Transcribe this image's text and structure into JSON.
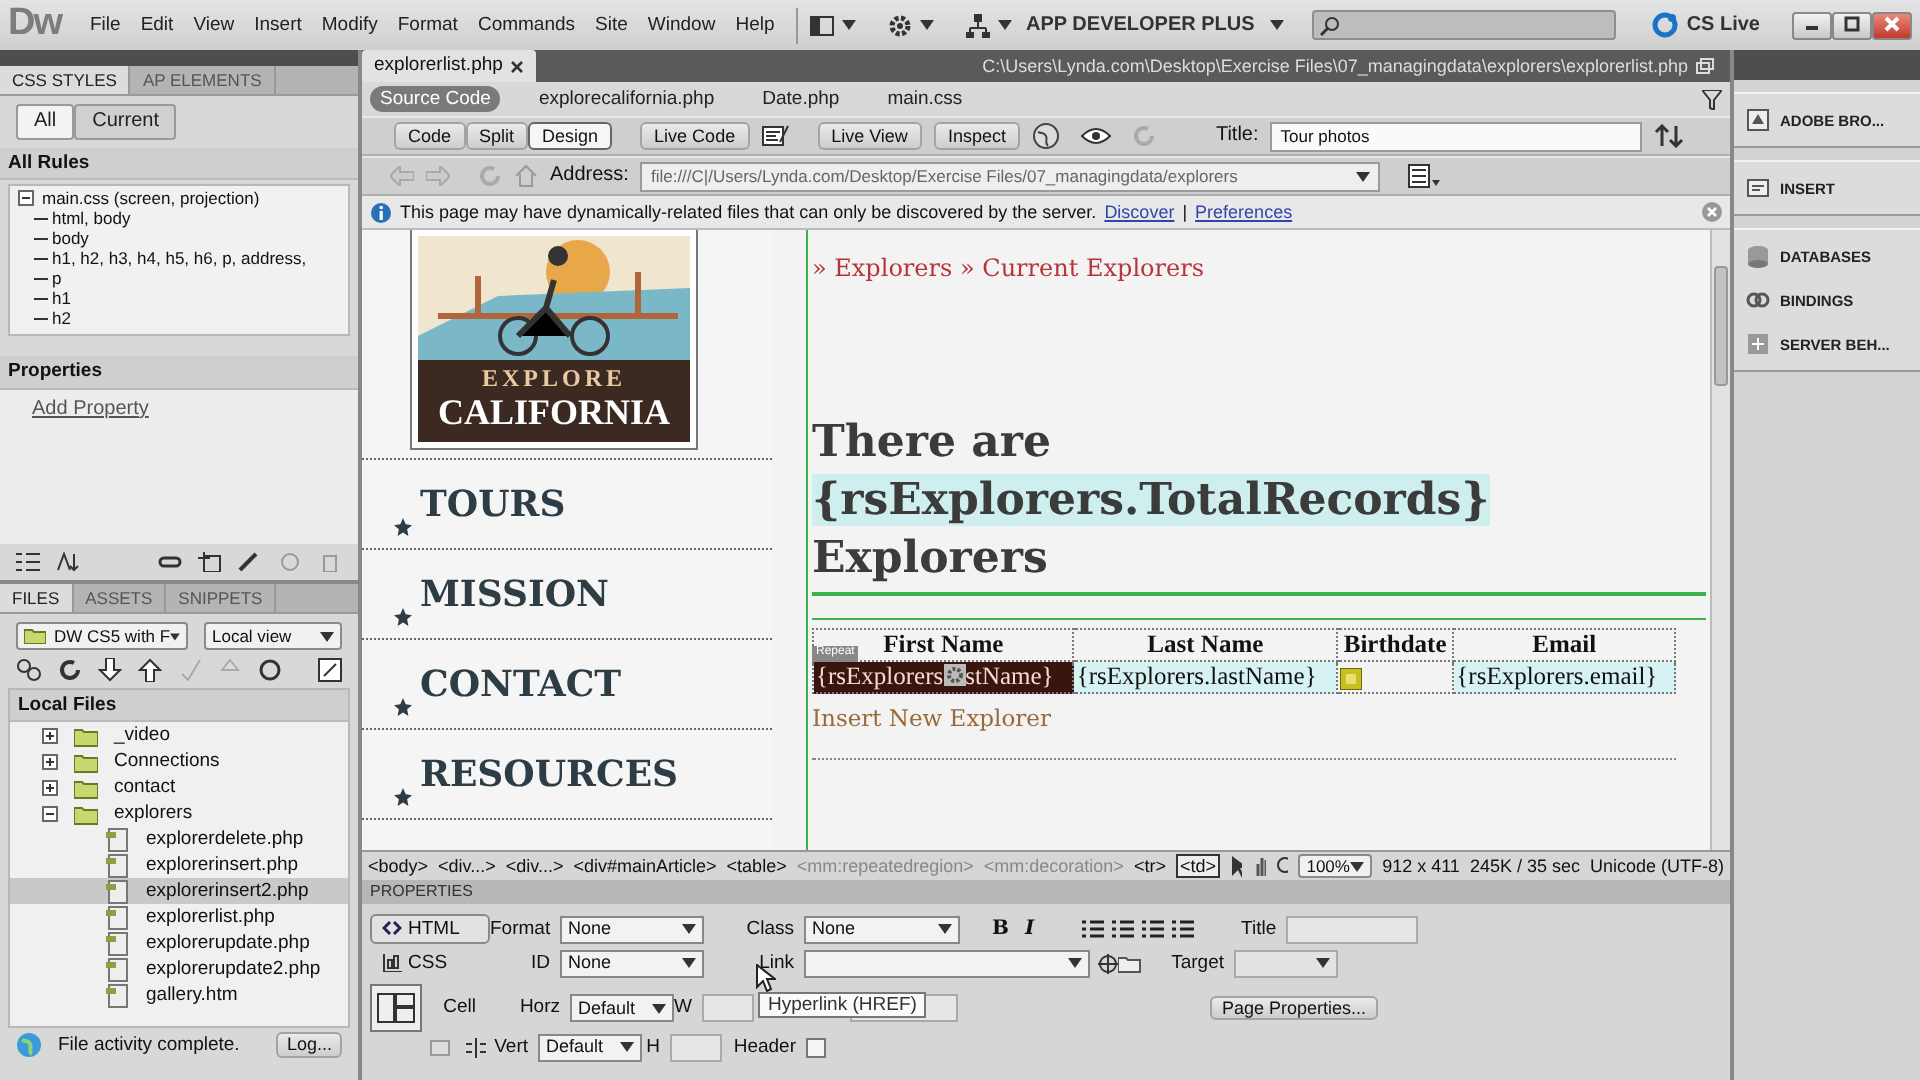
{
  "app": {
    "logo": "Dw",
    "menu": [
      "File",
      "Edit",
      "View",
      "Insert",
      "Modify",
      "Format",
      "Commands",
      "Site",
      "Window",
      "Help"
    ],
    "workspace": "APP DEVELOPER PLUS",
    "cs_live": "CS Live"
  },
  "css_panel": {
    "tabs": [
      {
        "label": "CSS STYLES",
        "selected": true
      },
      {
        "label": "AP ELEMENTS",
        "selected": false
      }
    ],
    "modes": [
      {
        "label": "All",
        "selected": true
      },
      {
        "label": "Current",
        "selected": false
      }
    ],
    "section": "All Rules",
    "rules": [
      {
        "label": "main.css (screen, projection)",
        "expanded": true,
        "children": [
          {
            "label": "html, body"
          },
          {
            "label": "body"
          },
          {
            "label": "h1, h2, h3, h4, h5, h6, p, address,"
          },
          {
            "label": "p"
          },
          {
            "label": "h1"
          },
          {
            "label": "h2"
          }
        ]
      }
    ],
    "properties_title": "Properties",
    "add_property": "Add Property"
  },
  "files_panel": {
    "tabs": [
      {
        "label": "FILES",
        "selected": true
      },
      {
        "label": "ASSETS",
        "selected": false
      },
      {
        "label": "SNIPPETS",
        "selected": false
      }
    ],
    "site": "DW CS5 with F",
    "view": "Local view",
    "section": "Local Files",
    "tree": [
      {
        "label": "_video",
        "kind": "folder",
        "expanded": false,
        "selected": false
      },
      {
        "label": "Connections",
        "kind": "folder",
        "expanded": false,
        "selected": false
      },
      {
        "label": "contact",
        "kind": "folder",
        "expanded": false,
        "selected": false
      },
      {
        "label": "explorers",
        "kind": "folder",
        "expanded": true,
        "selected": false,
        "children": [
          {
            "label": "explorerdelete.php",
            "kind": "file",
            "selected": false
          },
          {
            "label": "explorerinsert.php",
            "kind": "file",
            "selected": false
          },
          {
            "label": "explorerinsert2.php",
            "kind": "file",
            "selected": true
          },
          {
            "label": "explorerlist.php",
            "kind": "file",
            "selected": false
          },
          {
            "label": "explorerupdate.php",
            "kind": "file",
            "selected": false
          },
          {
            "label": "explorerupdate2.php",
            "kind": "file",
            "selected": false
          },
          {
            "label": "gallery.htm",
            "kind": "file",
            "selected": false
          }
        ]
      }
    ],
    "status": "File activity complete.",
    "log_button": "Log..."
  },
  "document": {
    "tab": "explorerlist.php",
    "path": "C:\\Users\\Lynda.com\\Desktop\\Exercise Files\\07_managingdata\\explorers\\explorerlist.php",
    "related_files": [
      {
        "label": "Source Code",
        "selected": true
      },
      {
        "label": "explorecalifornia.php",
        "selected": false
      },
      {
        "label": "Date.php",
        "selected": false
      },
      {
        "label": "main.css",
        "selected": false
      }
    ],
    "view_buttons": [
      {
        "label": "Code",
        "selected": false
      },
      {
        "label": "Split",
        "selected": false
      },
      {
        "label": "Design",
        "selected": true
      }
    ],
    "live_code": "Live Code",
    "live_view": "Live View",
    "inspect": "Inspect",
    "title_label": "Title:",
    "title_value": "Tour photos",
    "address_label": "Address:",
    "address_value": "file:///C|/Users/Lynda.com/Desktop/Exercise Files/07_managingdata/explorers",
    "info": {
      "message": "This page may have dynamically-related files that can only be discovered by the server.",
      "discover": "Discover",
      "separator": "|",
      "preferences": "Preferences"
    }
  },
  "page": {
    "logo": {
      "line_1": "EXPLORE",
      "line_2": "CALIFORNIA"
    },
    "nav": [
      "TOURS",
      "MISSION",
      "CONTACT",
      "RESOURCES"
    ],
    "breadcrumb": "» Explorers » Current Explorers",
    "heading": {
      "before": "There are",
      "binding": "{rsExplorers.TotalRecords}",
      "after": "Explorers"
    },
    "table": {
      "region_label": "Repeat",
      "columns": [
        "First Name",
        "Last Name",
        "Birthdate",
        "Email"
      ],
      "cells": [
        {
          "kind": "text",
          "parts": [
            "{rsExplorers",
            "stName}"
          ],
          "selected": true
        },
        {
          "kind": "text",
          "parts": [
            "{rsExplorers.lastName}"
          ],
          "selected": false
        },
        {
          "kind": "icon",
          "selected": false
        },
        {
          "kind": "text",
          "parts": [
            "{rsExplorers.email}"
          ],
          "selected": false
        }
      ]
    },
    "insert_link": "Insert New Explorer"
  },
  "tag_selector": {
    "tags": [
      {
        "label": "<body>",
        "dimmed": false,
        "selected": false
      },
      {
        "label": "<div...>",
        "dimmed": false,
        "selected": false
      },
      {
        "label": "<div...>",
        "dimmed": false,
        "selected": false
      },
      {
        "label": "<div#mainArticle>",
        "dimmed": false,
        "selected": false
      },
      {
        "label": "<table>",
        "dimmed": false,
        "selected": false
      },
      {
        "label": "<mm:repeatedregion>",
        "dimmed": true,
        "selected": false
      },
      {
        "label": "<mm:decoration>",
        "dimmed": true,
        "selected": false
      },
      {
        "label": "<tr>",
        "dimmed": false,
        "selected": false
      },
      {
        "label": "<td>",
        "dimmed": false,
        "selected": true
      }
    ],
    "zoom": "100%",
    "size": "912 x 411",
    "download": "245K / 35 sec",
    "encoding": "Unicode (UTF-8)"
  },
  "properties": {
    "title": "PROPERTIES",
    "modes": [
      {
        "label": "HTML",
        "selected": true
      },
      {
        "label": "CSS",
        "selected": false
      }
    ],
    "format_label": "Format",
    "format_value": "None",
    "id_label": "ID",
    "id_value": "None",
    "class_label": "Class",
    "class_value": "None",
    "bold_button": "B",
    "italic_button": "I",
    "link_label": "Link",
    "title_label": "Title",
    "target_label": "Target",
    "cell_label": "Cell",
    "horz_label": "Horz",
    "horz_value": "Default",
    "vert_label": "Vert",
    "vert_value": "Default",
    "w_label": "W",
    "h_label": "H",
    "header_label": "Header",
    "header_checked": false,
    "page_properties": "Page Properties...",
    "tooltip": "Hyperlink (HREF)"
  },
  "right_panel": {
    "groups": [
      [
        "ADOBE BRO..."
      ],
      [
        "INSERT"
      ],
      [
        "DATABASES",
        "BINDINGS",
        "SERVER BEH..."
      ]
    ]
  }
}
